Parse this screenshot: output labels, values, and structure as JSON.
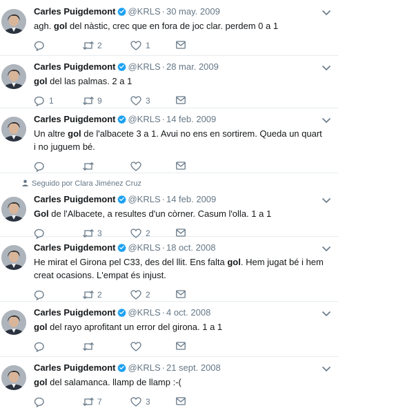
{
  "colors": {
    "text": "#14171a",
    "secondary": "#657786",
    "verified": "#1da1f2",
    "divider": "#e6ecf0"
  },
  "icons": {
    "reply": "speech-bubble-icon",
    "retweet": "retweet-arrows-icon",
    "like": "heart-icon",
    "dm": "envelope-icon",
    "caret": "chevron-down-icon",
    "verified": "verified-badge-icon",
    "social_context": "person-icon"
  },
  "tweets": [
    {
      "name": "Carles Puigdemont",
      "handle": "@KRLS",
      "sep": "·",
      "date": "30 may. 2009",
      "text_before": "agh. ",
      "text_bold": "gol",
      "text_after": " del nàstic, crec que en fora de joc clar. perdem 0 a 1",
      "reply_count": "",
      "retweet_count": "2",
      "like_count": "1"
    },
    {
      "name": "Carles Puigdemont",
      "handle": "@KRLS",
      "sep": "·",
      "date": "28 mar. 2009",
      "text_before": "",
      "text_bold": "gol",
      "text_after": " del las palmas. 2 a 1",
      "reply_count": "1",
      "retweet_count": "9",
      "like_count": "3"
    },
    {
      "name": "Carles Puigdemont",
      "handle": "@KRLS",
      "sep": "·",
      "date": "14 feb. 2009",
      "text_before": "Un altre ",
      "text_bold": "gol",
      "text_after": " de l'albacete 3 a 1. Avui no ens en sortirem. Queda un quart i no juguem bé.",
      "reply_count": "",
      "retweet_count": "",
      "like_count": ""
    },
    {
      "social_context": "Seguido por Clara Jiménez Cruz",
      "name": "Carles Puigdemont",
      "handle": "@KRLS",
      "sep": "·",
      "date": "14 feb. 2009",
      "text_before": "",
      "text_bold": "Gol",
      "text_after": " de l'Albacete, a resultes  d'un còrner. Casum l'olla. 1 a 1",
      "reply_count": "",
      "retweet_count": "3",
      "like_count": "2"
    },
    {
      "name": "Carles Puigdemont",
      "handle": "@KRLS",
      "sep": "·",
      "date": "18 oct. 2008",
      "text_before": "He mirat el Girona pel C33, des del llit. Ens falta ",
      "text_bold": "gol",
      "text_after": ". Hem jugat bé i hem creat ocasions. L'empat és injust.",
      "reply_count": "",
      "retweet_count": "2",
      "like_count": "2"
    },
    {
      "name": "Carles Puigdemont",
      "handle": "@KRLS",
      "sep": "·",
      "date": "4 oct. 2008",
      "text_before": "",
      "text_bold": "gol",
      "text_after": " del rayo aprofitant un error del girona. 1 a 1",
      "reply_count": "",
      "retweet_count": "",
      "like_count": ""
    },
    {
      "name": "Carles Puigdemont",
      "handle": "@KRLS",
      "sep": "·",
      "date": "21 sept. 2008",
      "text_before": "",
      "text_bold": "gol",
      "text_after": " del salamanca. llamp de llamp :-(",
      "reply_count": "",
      "retweet_count": "7",
      "like_count": "3"
    }
  ]
}
